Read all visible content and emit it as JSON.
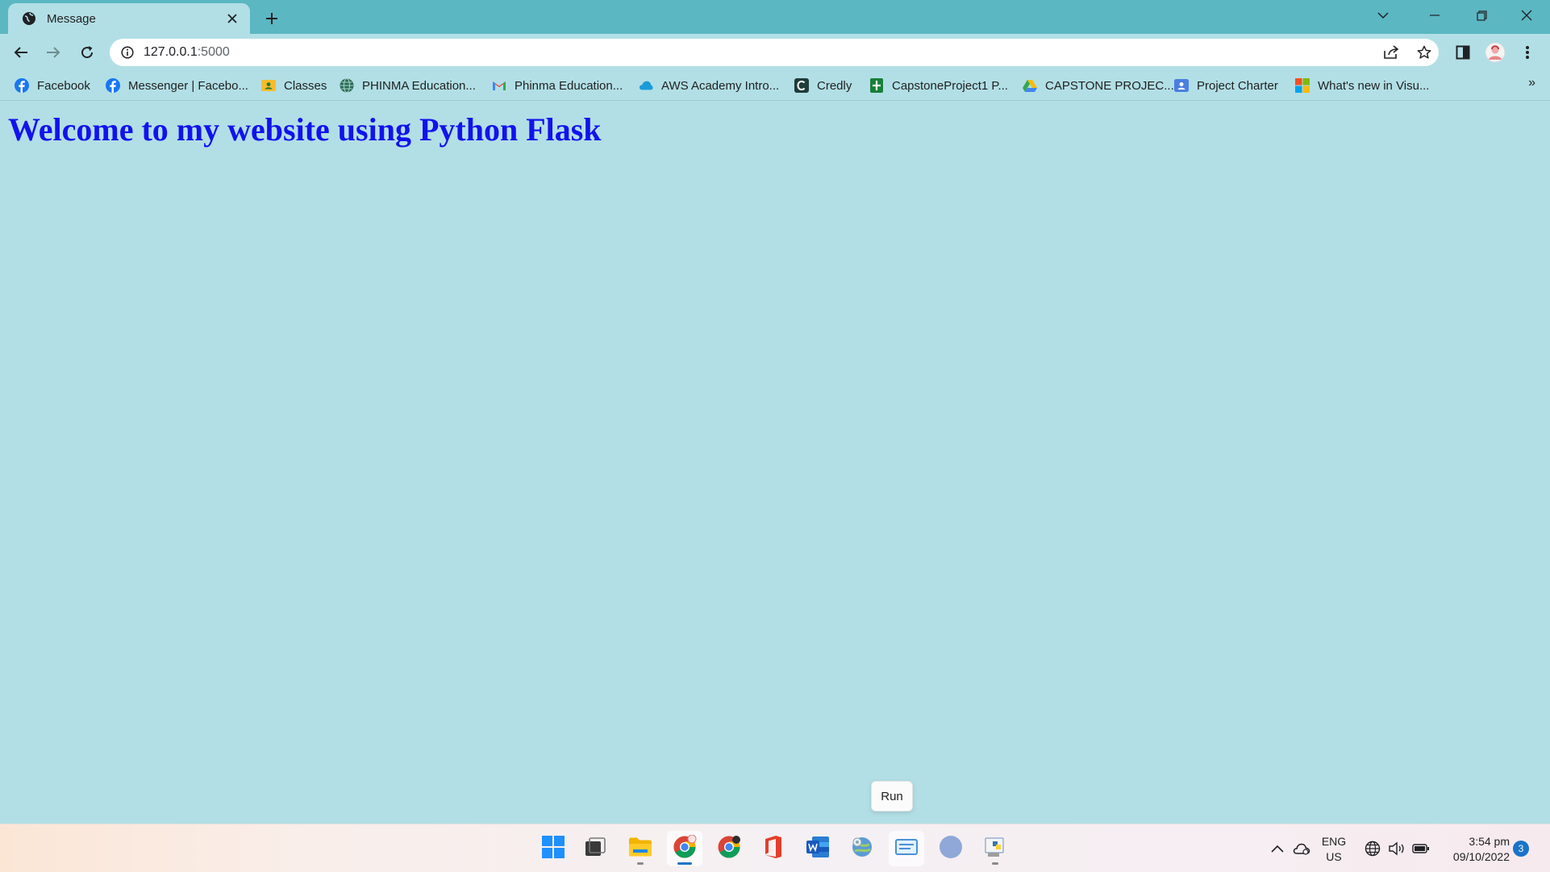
{
  "browser": {
    "tab": {
      "title": "Message",
      "favicon": "globe-icon"
    },
    "omnibox": {
      "host": "127.0.0.1",
      "port": ":5000"
    },
    "bookmarks": [
      {
        "label": "Facebook",
        "icon": "facebook-icon"
      },
      {
        "label": "Messenger | Facebo...",
        "icon": "facebook-icon"
      },
      {
        "label": "Classes",
        "icon": "classroom-icon"
      },
      {
        "label": "PHINMA Education...",
        "icon": "globe-icon"
      },
      {
        "label": "Phinma Education...",
        "icon": "gmail-icon"
      },
      {
        "label": "AWS Academy Intro...",
        "icon": "cloud-icon"
      },
      {
        "label": "Credly",
        "icon": "credly-icon"
      },
      {
        "label": "CapstoneProject1 P...",
        "icon": "sheets-icon"
      },
      {
        "label": "CAPSTONE PROJEC...",
        "icon": "drive-icon"
      },
      {
        "label": "Project Charter",
        "icon": "contact-icon"
      },
      {
        "label": "What's new in Visu...",
        "icon": "microsoft-icon"
      }
    ],
    "bookmarks_more": "»"
  },
  "page": {
    "heading": "Welcome to my website using Python Flask"
  },
  "tooltip": {
    "text": "Run"
  },
  "taskbar": {
    "apps": [
      "windows-start",
      "task-view",
      "file-explorer",
      "chrome",
      "chrome-profile",
      "office",
      "word",
      "edge-settings",
      "remote-desktop",
      "r-app",
      "python-idle"
    ],
    "language": {
      "line1": "ENG",
      "line2": "US"
    },
    "clock": {
      "time": "3:54 pm",
      "date": "09/10/2022"
    },
    "notifications": "3"
  },
  "colors": {
    "frame": "#5bb7c2",
    "page_background": "#b2dfe6",
    "heading": "#1212ee"
  }
}
